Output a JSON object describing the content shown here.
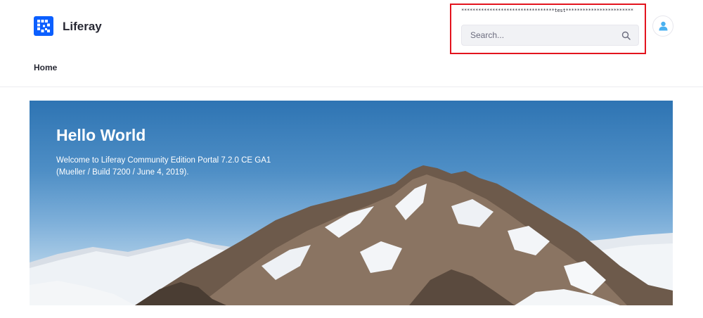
{
  "header": {
    "site_name": "Liferay",
    "masked_text": "*********************************test************************",
    "search": {
      "placeholder": "Search..."
    }
  },
  "nav": {
    "items": [
      {
        "label": "Home"
      }
    ]
  },
  "hero": {
    "title": "Hello World",
    "line1": "Welcome to Liferay Community Edition Portal 7.2.0 CE GA1",
    "line2": "(Mueller / Build 7200 / June 4, 2019)."
  },
  "colors": {
    "brand": "#0b5fff",
    "highlight": "#e3141e",
    "avatar_icon": "#4bb1f0"
  },
  "icons": [
    "liferay-logo-icon",
    "search-icon",
    "user-icon"
  ]
}
